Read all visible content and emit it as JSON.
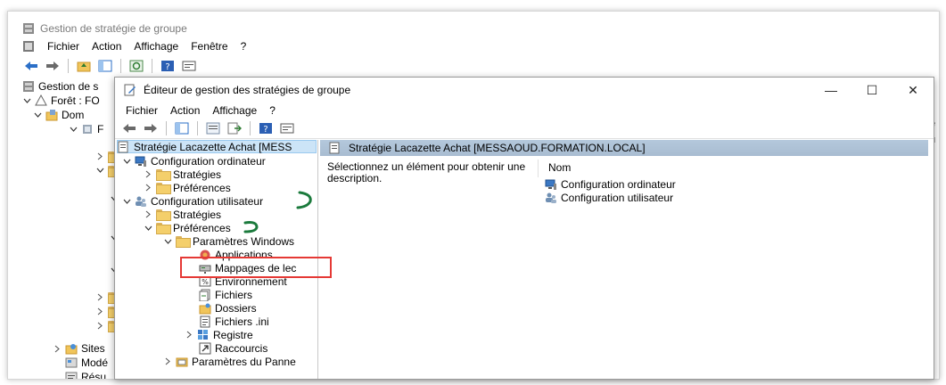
{
  "outer_window": {
    "title": "Gestion de stratégie de groupe",
    "menu": [
      "Fichier",
      "Action",
      "Affichage",
      "Fenêtre",
      "?"
    ],
    "tree": [
      {
        "label": "Gestion de s"
      },
      {
        "label": "Forêt : FO"
      },
      {
        "label": "Dom"
      },
      {
        "label": "F"
      },
      {
        "label": "Sites"
      },
      {
        "label": "Modé"
      },
      {
        "label": "Résu"
      }
    ],
    "edge_glyphs": [
      "e",
      "u"
    ]
  },
  "inner_window": {
    "title": "Éditeur de gestion des stratégies de groupe",
    "controls": {
      "minimize": "—",
      "maximize": "☐",
      "close": "✕"
    },
    "menu": [
      "Fichier",
      "Action",
      "Affichage",
      "?"
    ],
    "tree": {
      "root": "Stratégie Lacazette Achat [MESS",
      "computer_config": "Configuration ordinateur",
      "computer_strategies": "Stratégies",
      "computer_preferences": "Préférences",
      "user_config": "Configuration utilisateur",
      "user_strategies": "Stratégies",
      "user_preferences": "Préférences",
      "windows_params": "Paramètres Windows",
      "applications": "Applications",
      "drive_maps": "Mappages de lec",
      "environment": "Environnement",
      "files": "Fichiers",
      "folders": "Dossiers",
      "ini_files": "Fichiers .ini",
      "registry": "Registre",
      "shortcuts": "Raccourcis",
      "control_panel": "Paramètres du Panne"
    },
    "right_pane": {
      "header": "Stratégie Lacazette Achat [MESSAOUD.FORMATION.LOCAL]",
      "description": "Sélectionnez un élément pour obtenir une description.",
      "column_name": "Nom",
      "items": [
        "Configuration ordinateur",
        "Configuration utilisateur"
      ]
    }
  },
  "colors": {
    "annotation_red": "#e53935",
    "annotation_green": "#1b7a3c",
    "selection": "#cce4f7",
    "header_blue": "#b4c8dc"
  }
}
